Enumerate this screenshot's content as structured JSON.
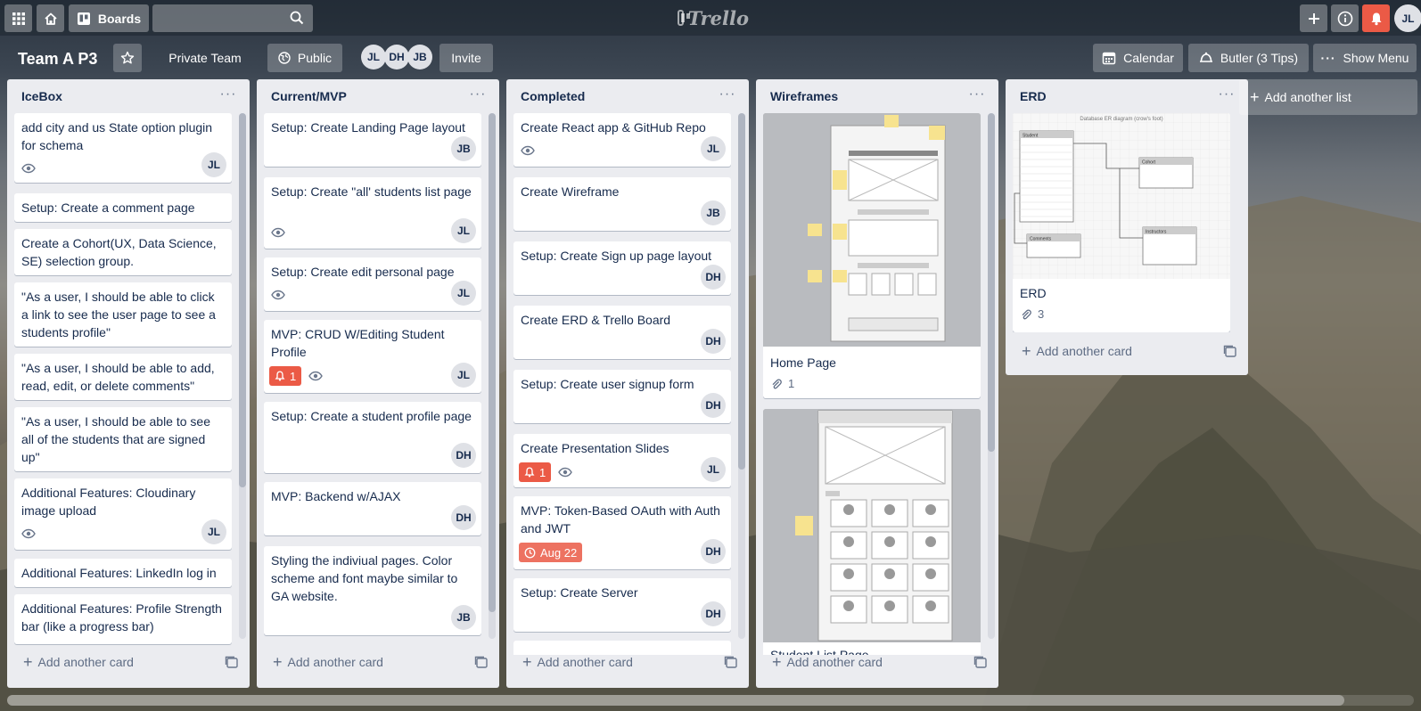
{
  "header": {
    "boards_label": "Boards",
    "search_value": "",
    "logo_text": "Trello",
    "user_initials": "JL"
  },
  "board": {
    "title": "Team A P3",
    "team_label": "Private Team",
    "visibility_label": "Public",
    "members": [
      "JL",
      "DH",
      "JB"
    ],
    "invite_label": "Invite",
    "calendar_label": "Calendar",
    "butler_label": "Butler (3 Tips)",
    "menu_label": "Show Menu",
    "add_list_label": "Add another list",
    "add_card_label": "Add another card"
  },
  "lists": [
    {
      "title": "IceBox",
      "cards": [
        {
          "title": "add city and us State option plugin for schema",
          "member": "JL",
          "watch": true
        },
        {
          "title": "Setup: Create a comment page"
        },
        {
          "title": "Create a Cohort(UX, Data Science, SE) selection group."
        },
        {
          "title": "\"As a user, I should be able to click a link to see the user page to see a students profile\""
        },
        {
          "title": "\"As a user, I should be able to add, read, edit, or delete comments\""
        },
        {
          "title": "\"As a user, I should be able to see all of the students that are signed up\""
        },
        {
          "title": "Additional Features: Cloudinary image upload",
          "member": "JL",
          "watch": true
        },
        {
          "title": "Additional Features: LinkedIn log in"
        },
        {
          "title": "Additional Features: Profile Strength bar (like a progress bar)"
        }
      ]
    },
    {
      "title": "Current/MVP",
      "cards": [
        {
          "title": "Setup: Create Landing Page layout",
          "member": "JB"
        },
        {
          "title": "Setup: Create \"all' students list page",
          "member": "JL",
          "watch": true
        },
        {
          "title": "Setup: Create edit personal page",
          "member": "JL",
          "watch": true
        },
        {
          "title": "MVP: CRUD W/Editing Student Profile",
          "member": "JL",
          "watch": true,
          "notifications": "1"
        },
        {
          "title": "Setup: Create a student profile page",
          "member": "DH"
        },
        {
          "title": "MVP: Backend w/AJAX",
          "member": "DH"
        },
        {
          "title": "Styling the indiviual pages. Color scheme and font maybe similar to GA website.",
          "member": "JB"
        }
      ]
    },
    {
      "title": "Completed",
      "cards": [
        {
          "title": "Create React app & GitHub Repo",
          "member": "JL",
          "watch": true
        },
        {
          "title": "Create Wireframe",
          "member": "JB"
        },
        {
          "title": "Setup: Create Sign up page layout",
          "member": "DH"
        },
        {
          "title": "Create ERD & Trello Board",
          "member": "DH"
        },
        {
          "title": "Setup: Create user signup form",
          "member": "DH"
        },
        {
          "title": "Create Presentation Slides",
          "member": "JL",
          "watch": true,
          "notifications": "1"
        },
        {
          "title": "MVP: Token-Based OAuth with Auth and JWT",
          "member": "DH",
          "due": "Aug 22"
        },
        {
          "title": "Setup: Create Server",
          "member": "DH"
        }
      ]
    },
    {
      "title": "Wireframes",
      "cards": [
        {
          "title": "Home Page",
          "attachments": "1"
        },
        {
          "title": "Student List Page"
        }
      ]
    },
    {
      "title": "ERD",
      "cards": [
        {
          "title": "ERD",
          "attachments": "3"
        }
      ],
      "erd_caption": "Database ER diagram (crow's foot)",
      "erd_entities": [
        "Student",
        "Cohort",
        "Comments",
        "Instructors"
      ]
    }
  ],
  "colors": {
    "list_bg": "#ebecf0",
    "card_bg": "#ffffff",
    "badge_red": "#eb5a46",
    "text": "#172b4d",
    "muted": "#5e6c84",
    "notification": "#eb5a46"
  }
}
